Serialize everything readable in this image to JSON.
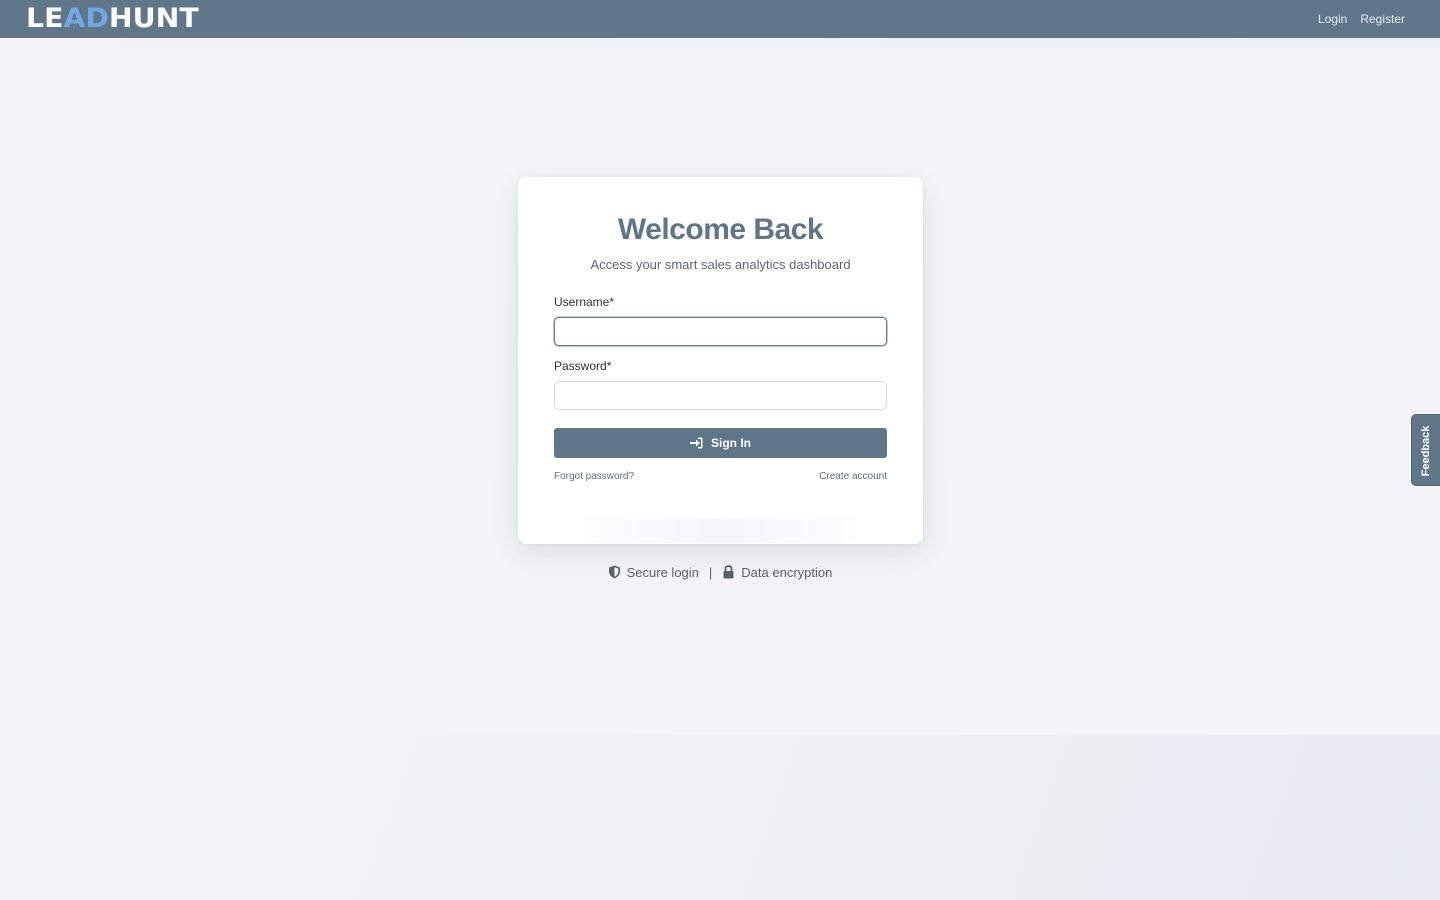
{
  "navbar": {
    "logo_part1": "LE",
    "logo_part2": "AD",
    "logo_part3": "HUNT",
    "links": [
      "Login",
      "Register"
    ]
  },
  "login_card": {
    "title": "Welcome Back",
    "subtitle": "Access your smart sales analytics dashboard",
    "username_label": "Username*",
    "username_value": "",
    "password_label": "Password*",
    "password_value": "",
    "signin_label": "Sign In",
    "signin_icon": "sign-in-icon",
    "forgot_link": "Forgot password?",
    "create_link": "Create account"
  },
  "security": {
    "item1": "Secure login",
    "item1_icon": "shield-icon",
    "separator": "|",
    "item2": "Data encryption",
    "item2_icon": "lock-icon"
  },
  "feedback_tab": {
    "label": "Feedback"
  },
  "colors": {
    "primary": "#607789",
    "logo_accent": "#6fa8e4",
    "background": "#f3f4f6",
    "card": "#ffffff"
  }
}
